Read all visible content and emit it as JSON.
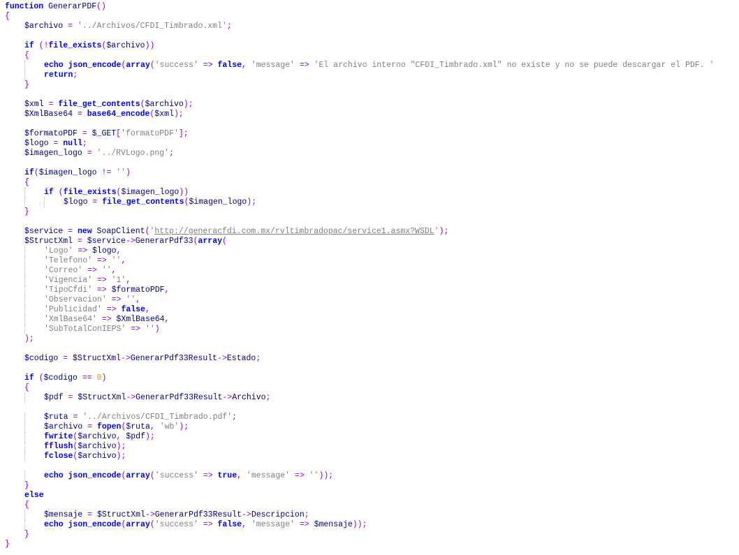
{
  "lines": [
    {
      "indent": 0,
      "tokens": [
        [
          "kw",
          "function"
        ],
        [
          "pl",
          " GenerarPDF"
        ],
        [
          "br",
          "()"
        ]
      ]
    },
    {
      "indent": 0,
      "tokens": [
        [
          "br",
          "{"
        ]
      ]
    },
    {
      "indent": 1,
      "tokens": [
        [
          "var",
          "$archivo"
        ],
        [
          "op",
          " = "
        ],
        [
          "str",
          "'../Archivos/CFDI_Timbrado.xml'"
        ],
        [
          "op",
          ";"
        ]
      ]
    },
    {
      "indent": 0,
      "tokens": []
    },
    {
      "indent": 1,
      "tokens": [
        [
          "kw",
          "if"
        ],
        [
          "op",
          " ("
        ],
        [
          "op",
          "!"
        ],
        [
          "kw",
          "file_exists"
        ],
        [
          "op",
          "("
        ],
        [
          "var",
          "$archivo"
        ],
        [
          "op",
          "))"
        ]
      ]
    },
    {
      "indent": 1,
      "tokens": [
        [
          "br",
          "{"
        ]
      ]
    },
    {
      "indent": 2,
      "tokens": [
        [
          "kw",
          "echo"
        ],
        [
          "pl",
          " "
        ],
        [
          "kw",
          "json_encode"
        ],
        [
          "op",
          "("
        ],
        [
          "kw",
          "array"
        ],
        [
          "op",
          "("
        ],
        [
          "str",
          "'success'"
        ],
        [
          "op",
          " => "
        ],
        [
          "kw",
          "false"
        ],
        [
          "op",
          ", "
        ],
        [
          "str",
          "'message'"
        ],
        [
          "op",
          " => "
        ],
        [
          "str",
          "'El archivo interno \"CFDI_Timbrado.xml\" no existe y no se puede descargar el PDF. '"
        ]
      ]
    },
    {
      "indent": 2,
      "tokens": [
        [
          "kw",
          "return"
        ],
        [
          "op",
          ";"
        ]
      ]
    },
    {
      "indent": 1,
      "tokens": [
        [
          "br",
          "}"
        ]
      ]
    },
    {
      "indent": 0,
      "tokens": []
    },
    {
      "indent": 1,
      "tokens": [
        [
          "var",
          "$xml"
        ],
        [
          "op",
          " = "
        ],
        [
          "kw",
          "file_get_contents"
        ],
        [
          "op",
          "("
        ],
        [
          "var",
          "$archivo"
        ],
        [
          "op",
          ");"
        ]
      ]
    },
    {
      "indent": 1,
      "tokens": [
        [
          "var",
          "$XmlBase64"
        ],
        [
          "op",
          " = "
        ],
        [
          "kw",
          "base64_encode"
        ],
        [
          "op",
          "("
        ],
        [
          "var",
          "$xml"
        ],
        [
          "op",
          ");"
        ]
      ]
    },
    {
      "indent": 0,
      "tokens": []
    },
    {
      "indent": 1,
      "tokens": [
        [
          "var",
          "$formatoPDF"
        ],
        [
          "op",
          " = "
        ],
        [
          "var",
          "$_GET"
        ],
        [
          "op",
          "["
        ],
        [
          "str",
          "'formatoPDF'"
        ],
        [
          "op",
          "];"
        ]
      ]
    },
    {
      "indent": 1,
      "tokens": [
        [
          "var",
          "$logo"
        ],
        [
          "op",
          " = "
        ],
        [
          "kw",
          "null"
        ],
        [
          "op",
          ";"
        ]
      ]
    },
    {
      "indent": 1,
      "tokens": [
        [
          "var",
          "$imagen_logo"
        ],
        [
          "op",
          " = "
        ],
        [
          "str",
          "'../RVLogo.png'"
        ],
        [
          "op",
          ";"
        ]
      ]
    },
    {
      "indent": 0,
      "tokens": []
    },
    {
      "indent": 1,
      "tokens": [
        [
          "kw",
          "if"
        ],
        [
          "op",
          "("
        ],
        [
          "var",
          "$imagen_logo"
        ],
        [
          "op",
          " != "
        ],
        [
          "str",
          "''"
        ],
        [
          "op",
          ")"
        ]
      ]
    },
    {
      "indent": 1,
      "tokens": [
        [
          "br",
          "{"
        ]
      ]
    },
    {
      "indent": 2,
      "tokens": [
        [
          "kw",
          "if"
        ],
        [
          "op",
          " ("
        ],
        [
          "kw",
          "file_exists"
        ],
        [
          "op",
          "("
        ],
        [
          "var",
          "$imagen_logo"
        ],
        [
          "op",
          "))"
        ]
      ]
    },
    {
      "indent": 3,
      "tokens": [
        [
          "var",
          "$logo"
        ],
        [
          "op",
          " = "
        ],
        [
          "kw",
          "file_get_contents"
        ],
        [
          "op",
          "("
        ],
        [
          "var",
          "$imagen_logo"
        ],
        [
          "op",
          ");"
        ]
      ]
    },
    {
      "indent": 1,
      "tokens": [
        [
          "br",
          "}"
        ]
      ]
    },
    {
      "indent": 0,
      "tokens": []
    },
    {
      "indent": 1,
      "tokens": [
        [
          "var",
          "$service"
        ],
        [
          "op",
          " = "
        ],
        [
          "kw",
          "new"
        ],
        [
          "pl",
          " SoapClient"
        ],
        [
          "op",
          "("
        ],
        [
          "str",
          "'"
        ],
        [
          "url",
          "http://generacfdi.com.mx/rvltimbradopac/service1.asmx?WSDL"
        ],
        [
          "str",
          "'"
        ],
        [
          "op",
          ");"
        ]
      ]
    },
    {
      "indent": 1,
      "tokens": [
        [
          "var",
          "$StructXml"
        ],
        [
          "op",
          " = "
        ],
        [
          "var",
          "$service"
        ],
        [
          "op",
          "->"
        ],
        [
          "pl",
          "GenerarPdf33"
        ],
        [
          "op",
          "("
        ],
        [
          "kw",
          "array"
        ],
        [
          "op",
          "("
        ]
      ]
    },
    {
      "indent": 2,
      "tokens": [
        [
          "str",
          "'Logo'"
        ],
        [
          "op",
          " => "
        ],
        [
          "var",
          "$logo"
        ],
        [
          "op",
          ","
        ]
      ]
    },
    {
      "indent": 2,
      "tokens": [
        [
          "str",
          "'Telefono'"
        ],
        [
          "op",
          " => "
        ],
        [
          "str",
          "''"
        ],
        [
          "op",
          ","
        ]
      ]
    },
    {
      "indent": 2,
      "tokens": [
        [
          "str",
          "'Correo'"
        ],
        [
          "op",
          " => "
        ],
        [
          "str",
          "''"
        ],
        [
          "op",
          ","
        ]
      ]
    },
    {
      "indent": 2,
      "tokens": [
        [
          "str",
          "'Vigencia'"
        ],
        [
          "op",
          " => "
        ],
        [
          "str",
          "'1'"
        ],
        [
          "op",
          ","
        ]
      ]
    },
    {
      "indent": 2,
      "tokens": [
        [
          "str",
          "'TipoCfdi'"
        ],
        [
          "op",
          " => "
        ],
        [
          "var",
          "$formatoPDF"
        ],
        [
          "op",
          ","
        ]
      ]
    },
    {
      "indent": 2,
      "tokens": [
        [
          "str",
          "'Observacion'"
        ],
        [
          "op",
          " => "
        ],
        [
          "str",
          "''"
        ],
        [
          "op",
          ","
        ]
      ]
    },
    {
      "indent": 2,
      "tokens": [
        [
          "str",
          "'Publicidad'"
        ],
        [
          "op",
          " => "
        ],
        [
          "kw",
          "false"
        ],
        [
          "op",
          ","
        ]
      ]
    },
    {
      "indent": 2,
      "tokens": [
        [
          "str",
          "'XmlBase64'"
        ],
        [
          "op",
          " => "
        ],
        [
          "var",
          "$XmlBase64"
        ],
        [
          "op",
          ","
        ]
      ]
    },
    {
      "indent": 2,
      "tokens": [
        [
          "str",
          "'SubTotalConIEPS'"
        ],
        [
          "op",
          " => "
        ],
        [
          "str",
          "''"
        ],
        [
          "op",
          ")"
        ]
      ]
    },
    {
      "indent": 1,
      "tokens": [
        [
          "op",
          ");"
        ]
      ]
    },
    {
      "indent": 0,
      "tokens": []
    },
    {
      "indent": 1,
      "tokens": [
        [
          "var",
          "$codigo"
        ],
        [
          "op",
          " = "
        ],
        [
          "var",
          "$StructXml"
        ],
        [
          "op",
          "->"
        ],
        [
          "pl",
          "GenerarPdf33Result"
        ],
        [
          "op",
          "->"
        ],
        [
          "pl",
          "Estado"
        ],
        [
          "op",
          ";"
        ]
      ]
    },
    {
      "indent": 0,
      "tokens": []
    },
    {
      "indent": 1,
      "tokens": [
        [
          "kw",
          "if"
        ],
        [
          "op",
          " ("
        ],
        [
          "var",
          "$codigo"
        ],
        [
          "op",
          " == "
        ],
        [
          "num",
          "0"
        ],
        [
          "op",
          ")"
        ]
      ]
    },
    {
      "indent": 1,
      "tokens": [
        [
          "br",
          "{"
        ]
      ]
    },
    {
      "indent": 2,
      "tokens": [
        [
          "var",
          "$pdf"
        ],
        [
          "op",
          " = "
        ],
        [
          "var",
          "$StructXml"
        ],
        [
          "op",
          "->"
        ],
        [
          "pl",
          "GenerarPdf33Result"
        ],
        [
          "op",
          "->"
        ],
        [
          "pl",
          "Archivo"
        ],
        [
          "op",
          ";"
        ]
      ]
    },
    {
      "indent": 0,
      "tokens": []
    },
    {
      "indent": 2,
      "tokens": [
        [
          "var",
          "$ruta"
        ],
        [
          "op",
          " = "
        ],
        [
          "str",
          "'../Archivos/CFDI_Timbrado.pdf'"
        ],
        [
          "op",
          ";"
        ]
      ]
    },
    {
      "indent": 2,
      "tokens": [
        [
          "var",
          "$archivo"
        ],
        [
          "op",
          " = "
        ],
        [
          "kw",
          "fopen"
        ],
        [
          "op",
          "("
        ],
        [
          "var",
          "$ruta"
        ],
        [
          "op",
          ", "
        ],
        [
          "str",
          "'wb'"
        ],
        [
          "op",
          ");"
        ]
      ]
    },
    {
      "indent": 2,
      "tokens": [
        [
          "kw",
          "fwrite"
        ],
        [
          "op",
          "("
        ],
        [
          "var",
          "$archivo"
        ],
        [
          "op",
          ", "
        ],
        [
          "var",
          "$pdf"
        ],
        [
          "op",
          ");"
        ]
      ]
    },
    {
      "indent": 2,
      "tokens": [
        [
          "kw",
          "fflush"
        ],
        [
          "op",
          "("
        ],
        [
          "var",
          "$archivo"
        ],
        [
          "op",
          ");"
        ]
      ]
    },
    {
      "indent": 2,
      "tokens": [
        [
          "kw",
          "fclose"
        ],
        [
          "op",
          "("
        ],
        [
          "var",
          "$archivo"
        ],
        [
          "op",
          ");"
        ]
      ]
    },
    {
      "indent": 0,
      "tokens": []
    },
    {
      "indent": 2,
      "tokens": [
        [
          "kw",
          "echo"
        ],
        [
          "pl",
          " "
        ],
        [
          "kw",
          "json_encode"
        ],
        [
          "op",
          "("
        ],
        [
          "kw",
          "array"
        ],
        [
          "op",
          "("
        ],
        [
          "str",
          "'success'"
        ],
        [
          "op",
          " => "
        ],
        [
          "kw",
          "true"
        ],
        [
          "op",
          ", "
        ],
        [
          "str",
          "'message'"
        ],
        [
          "op",
          " => "
        ],
        [
          "str",
          "''"
        ],
        [
          "op",
          "));"
        ]
      ]
    },
    {
      "indent": 1,
      "tokens": [
        [
          "br",
          "}"
        ]
      ]
    },
    {
      "indent": 1,
      "tokens": [
        [
          "kw",
          "else"
        ]
      ]
    },
    {
      "indent": 1,
      "tokens": [
        [
          "br",
          "{"
        ]
      ]
    },
    {
      "indent": 2,
      "tokens": [
        [
          "var",
          "$mensaje"
        ],
        [
          "op",
          " = "
        ],
        [
          "var",
          "$StructXml"
        ],
        [
          "op",
          "->"
        ],
        [
          "pl",
          "GenerarPdf33Result"
        ],
        [
          "op",
          "->"
        ],
        [
          "pl",
          "Descripcion"
        ],
        [
          "op",
          ";"
        ]
      ]
    },
    {
      "indent": 2,
      "tokens": [
        [
          "kw",
          "echo"
        ],
        [
          "pl",
          " "
        ],
        [
          "kw",
          "json_encode"
        ],
        [
          "op",
          "("
        ],
        [
          "kw",
          "array"
        ],
        [
          "op",
          "("
        ],
        [
          "str",
          "'success'"
        ],
        [
          "op",
          " => "
        ],
        [
          "kw",
          "false"
        ],
        [
          "op",
          ", "
        ],
        [
          "str",
          "'message'"
        ],
        [
          "op",
          " => "
        ],
        [
          "var",
          "$mensaje"
        ],
        [
          "op",
          "));"
        ]
      ]
    },
    {
      "indent": 1,
      "tokens": [
        [
          "br",
          "}"
        ]
      ]
    },
    {
      "indent": 0,
      "tokens": [
        [
          "br",
          "}"
        ]
      ]
    }
  ]
}
